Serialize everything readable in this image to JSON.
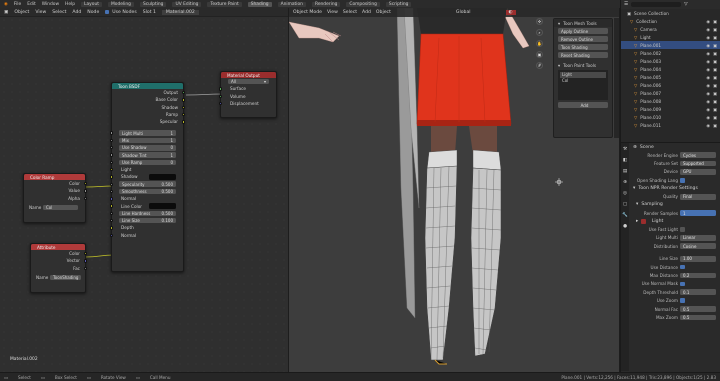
{
  "menu": {
    "items": [
      "File",
      "Edit",
      "Window",
      "Help"
    ],
    "workspaces": [
      "Layout",
      "Modeling",
      "Sculpting",
      "UV Editing",
      "Texture Paint",
      "Shading",
      "Animation",
      "Rendering",
      "Compositing",
      "Scripting"
    ],
    "active_workspace": "Shading"
  },
  "node_editor": {
    "header": {
      "mode": "Object",
      "view": "View",
      "select": "Select",
      "add": "Add",
      "node": "Node",
      "use_nodes": "Use Nodes",
      "slot": "Slot 1",
      "material": "Material.002"
    },
    "material_name": "Material.002",
    "nodes": {
      "material_output": {
        "title": "Material Output",
        "target": "All",
        "inputs": [
          "Surface",
          "Volume",
          "Displacement"
        ]
      },
      "bsdf": {
        "title": "Toon BSDF",
        "outputs": [
          "Output",
          "Base Color",
          "Shadow",
          "Ramp",
          "Specular"
        ],
        "fields": [
          {
            "label": "Light Multi",
            "value": "1"
          },
          {
            "label": "Mix",
            "value": "1"
          },
          {
            "label": "Use Shadow",
            "value": "0"
          },
          {
            "label": "Shadow Tint",
            "value": "1"
          },
          {
            "label": "Use Ramp",
            "value": "0"
          }
        ],
        "inputs": [
          {
            "label": "Light",
            "type": "socket"
          },
          {
            "label": "Shadow",
            "type": "color"
          },
          {
            "label": "Specularity",
            "value": "0.500"
          },
          {
            "label": "Smoothness",
            "value": "0.500"
          },
          {
            "label": "Normal",
            "type": "socket"
          },
          {
            "label": "Line Color",
            "type": "color"
          },
          {
            "label": "Line Hardness",
            "value": "0.500"
          },
          {
            "label": "Line Size",
            "value": "0.100"
          },
          {
            "label": "Depth",
            "type": "socket"
          },
          {
            "label": "Normal",
            "type": "socket"
          }
        ]
      },
      "color": {
        "title": "Color Ramp",
        "outputs": [
          "Color",
          "Value",
          "Alpha"
        ],
        "name_label": "Name",
        "name_value": "Col"
      },
      "attribute": {
        "title": "Attribute",
        "outputs": [
          "Color",
          "Vector",
          "Fac"
        ],
        "name_label": "Name",
        "name_value": "ToonShading"
      }
    }
  },
  "viewport": {
    "header": {
      "mode": "Object Mode",
      "view": "View",
      "select": "Select",
      "add": "Add",
      "object": "Object",
      "transform": "Global"
    },
    "n_panel": {
      "title": "Toon Mesh Tools",
      "rows": [
        "Apply Outline",
        "Remove Outline",
        "Toon Shading",
        "Reset Shading"
      ],
      "section": "Toon Paint Tools",
      "list_items": [
        "Light",
        "Col"
      ],
      "add_button": "Add"
    }
  },
  "outliner": {
    "title": "Scene Collection",
    "rows": [
      {
        "name": "Collection",
        "selected": false
      },
      {
        "name": "Camera",
        "selected": false
      },
      {
        "name": "Light",
        "selected": false
      },
      {
        "name": "Plane.001",
        "selected": true
      },
      {
        "name": "Plane.002",
        "selected": false
      },
      {
        "name": "Plane.003",
        "selected": false
      },
      {
        "name": "Plane.004",
        "selected": false
      },
      {
        "name": "Plane.005",
        "selected": false
      },
      {
        "name": "Plane.006",
        "selected": false
      },
      {
        "name": "Plane.007",
        "selected": false
      },
      {
        "name": "Plane.008",
        "selected": false
      },
      {
        "name": "Plane.009",
        "selected": false
      },
      {
        "name": "Plane.010",
        "selected": false
      },
      {
        "name": "Plane.011",
        "selected": false
      }
    ]
  },
  "properties": {
    "section": "Scene",
    "rows": [
      {
        "label": "Render Engine",
        "value": "Cycles"
      },
      {
        "label": "Feature Set",
        "value": "Supported"
      },
      {
        "label": "Device",
        "value": "GPU"
      },
      {
        "label": "Open Shading Lang",
        "value": "",
        "checkbox": true
      }
    ],
    "subsection": "Toon NPR Render Settings",
    "quality": {
      "label": "Quality",
      "value": "Final"
    },
    "subsection2": "Sampling",
    "samples": {
      "label": "Render Samples",
      "value": "1"
    },
    "subsection3": "Light",
    "light_rows": [
      {
        "label": "Use Fast Light",
        "value": ""
      },
      {
        "label": "Light Multi",
        "value": "Linear"
      },
      {
        "label": "Distribution",
        "value": "Cosine"
      }
    ],
    "bottom_rows": [
      {
        "label": "Line Size",
        "value": "1.00"
      },
      {
        "label": "Use Distance",
        "value": "",
        "checkbox": true
      },
      {
        "label": "Max Distance",
        "value": "0.2"
      },
      {
        "label": "Use Normal Mask",
        "value": "",
        "checkbox": true
      },
      {
        "label": "Depth Threshold",
        "value": "0.1"
      },
      {
        "label": "Use Zoom",
        "value": "",
        "checkbox": true
      },
      {
        "label": "Normal Fac",
        "value": "0.5"
      },
      {
        "label": "Max Zoom",
        "value": "0.5"
      }
    ]
  },
  "status": {
    "left": [
      "Select",
      "Box Select",
      "Rotate View",
      "Call Menu"
    ],
    "right": "Plane.001 | Verts:12,256 | Faces:11,948 | Tris:23,896 | Objects:1/25 | 2.83"
  },
  "colors": {
    "material_output_header": "#9b2d2d",
    "bsdf_header": "#1f6f6a",
    "color_header": "#b03a3a",
    "socket_yellow": "#c7c729",
    "socket_gray": "#a1a1a1",
    "socket_purple": "#6363c7",
    "socket_green": "#63c763",
    "skirt_red": "#e0341c",
    "skirt_dark": "#a82414",
    "select_blue": "#4772b3"
  }
}
